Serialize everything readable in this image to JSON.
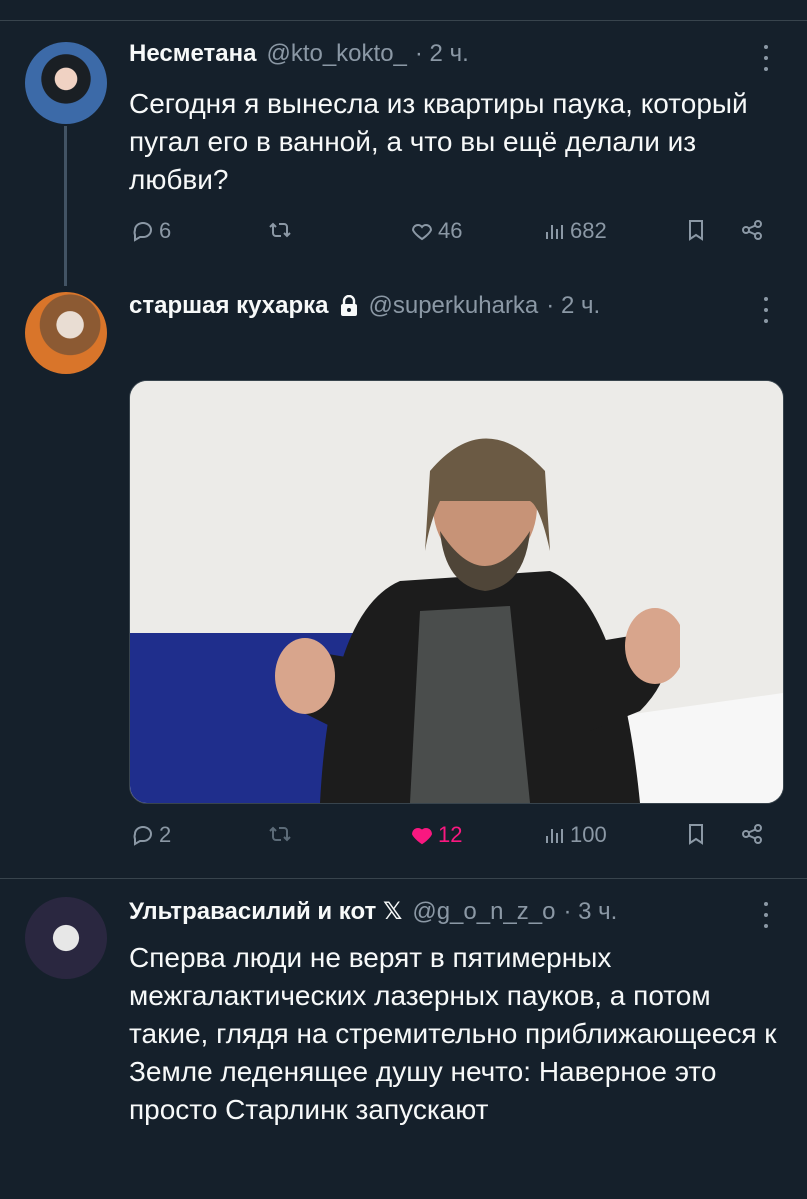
{
  "tweets": [
    {
      "name": "Несметана",
      "handle": "@kto_kokto_",
      "time": "· 2 ч.",
      "text": "Сегодня я вынесла из квартиры паука, который пугал его в ванной, а что вы ещё делали из любви?",
      "replies": "6",
      "retweets": "",
      "likes": "46",
      "views": "682"
    },
    {
      "name": "старшая кухарка",
      "handle": "@superkuharka",
      "time": "· 2 ч.",
      "replies": "2",
      "retweets": "",
      "likes": "12",
      "views": "100"
    },
    {
      "name": "Ультравасилий и кот 𝕏",
      "handle": "@g_o_n_z_o",
      "time": "· 3 ч.",
      "text": "Сперва люди не верят в пятимерных межгалактических лазерных пауков, а потом такие, глядя на стремительно приближающееся к Земле леденящее душу нечто: Наверное это просто Старлинк запускают"
    }
  ],
  "colors": {
    "background": "#15202b",
    "text": "#f7f9f9",
    "muted": "#8b98a5",
    "like": "#f91880"
  },
  "icons": [
    "reply-icon",
    "retweet-icon",
    "like-icon",
    "views-icon",
    "bookmark-icon",
    "share-icon",
    "more-icon",
    "lock-icon"
  ]
}
